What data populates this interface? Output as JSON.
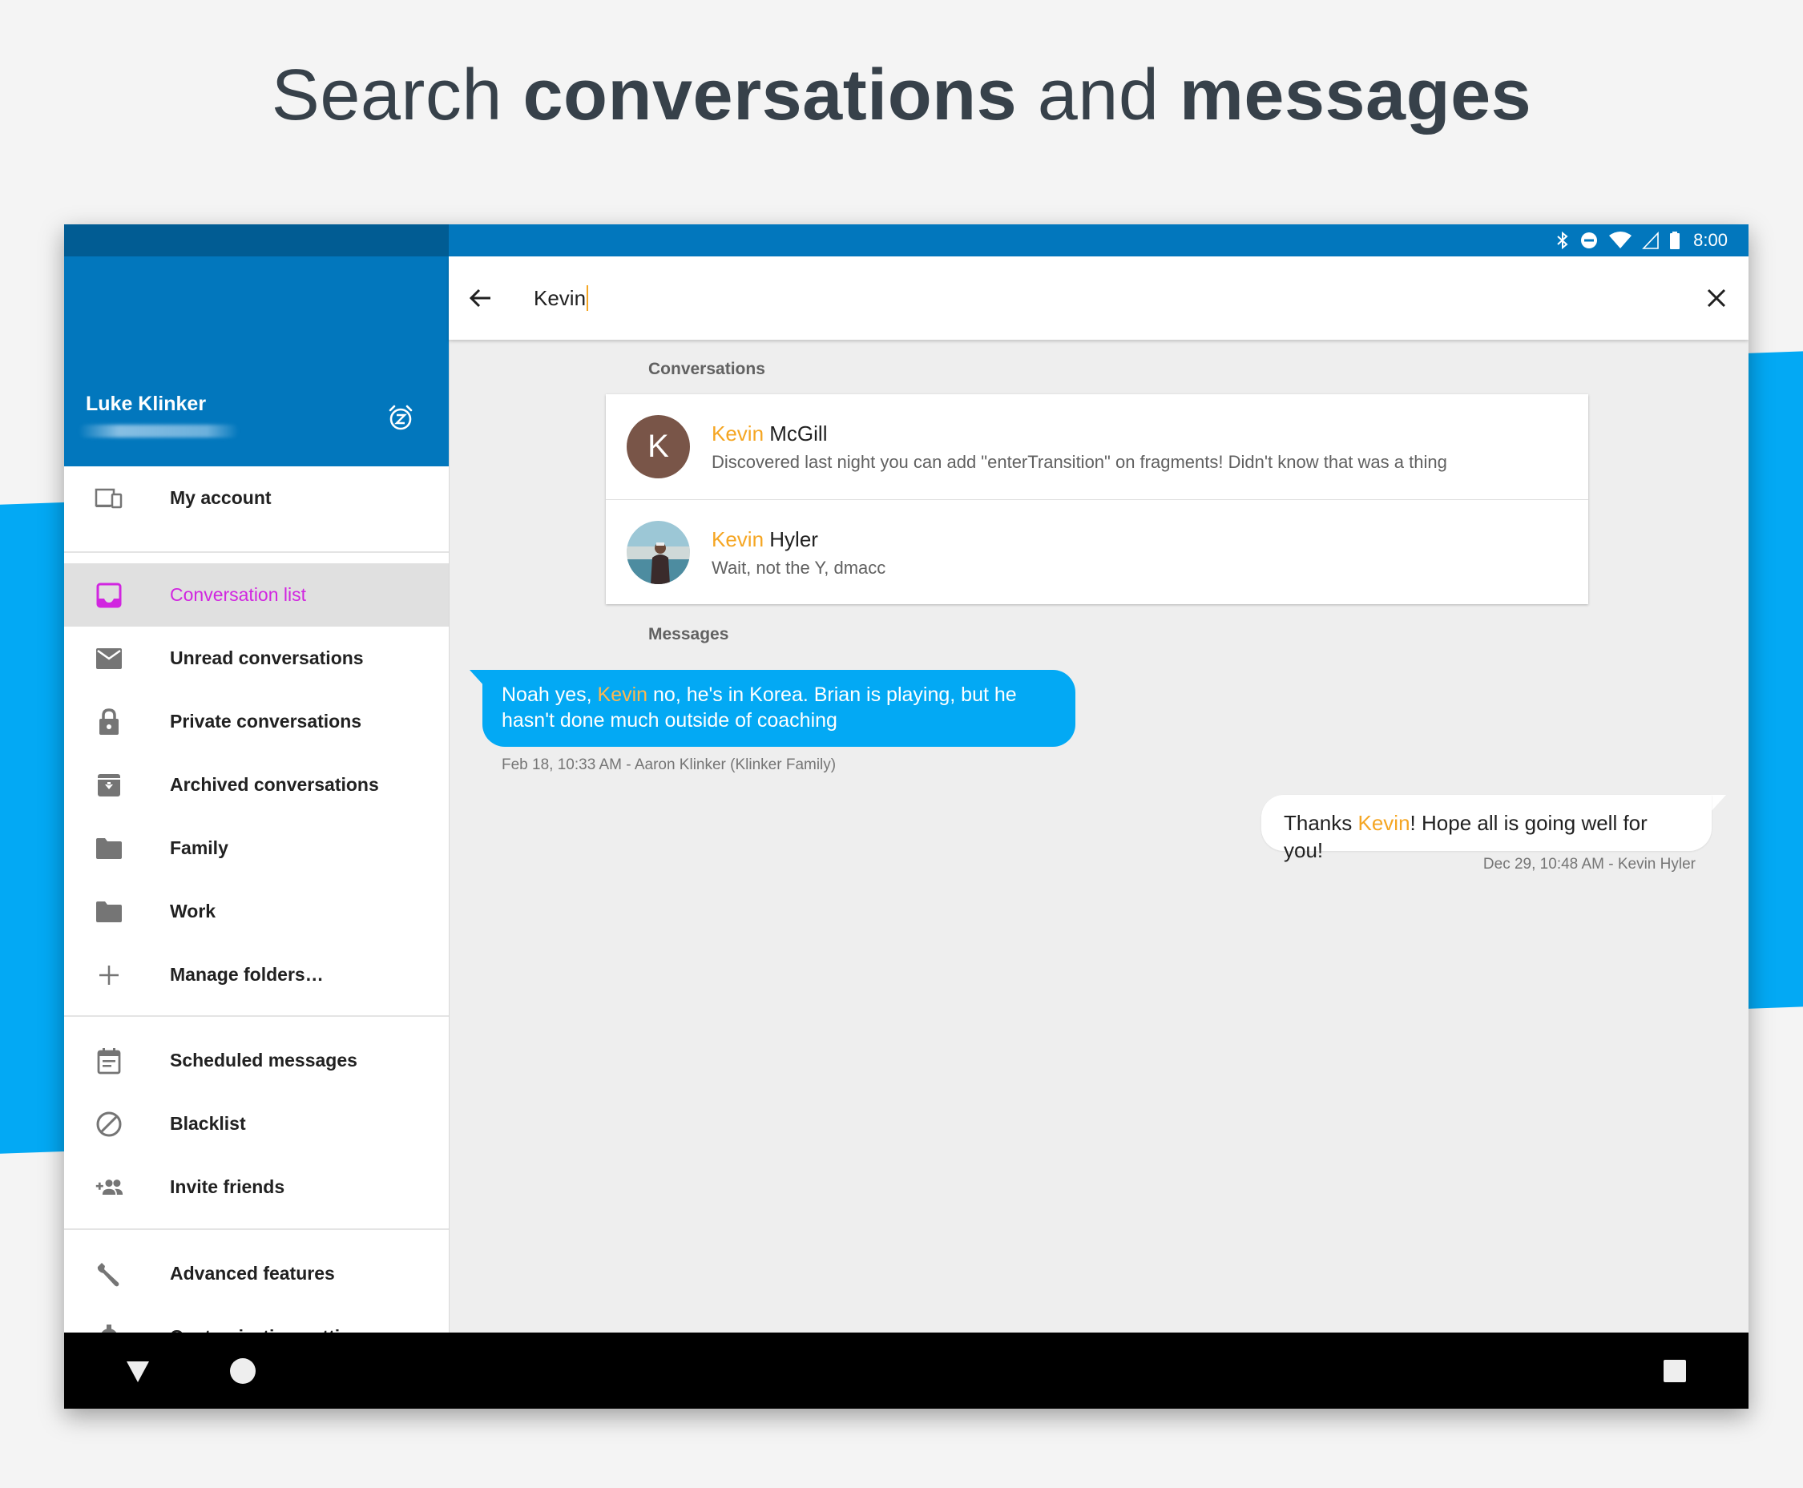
{
  "headline": {
    "part1": "Search ",
    "part2": "conversations",
    "part3": " and ",
    "part4": "messages"
  },
  "status_bar": {
    "time": "8:00",
    "icons": [
      "bluetooth-icon",
      "do-not-disturb-icon",
      "wifi-icon",
      "signal-icon",
      "battery-icon"
    ]
  },
  "drawer": {
    "user_name": "Luke Klinker",
    "snooze_icon": "snooze-alarm-icon",
    "items": [
      {
        "label": "My account",
        "icon": "devices-icon"
      },
      {
        "label": "Conversation list",
        "icon": "inbox-icon",
        "active": true
      },
      {
        "label": "Unread conversations",
        "icon": "mail-icon"
      },
      {
        "label": "Private conversations",
        "icon": "lock-icon"
      },
      {
        "label": "Archived conversations",
        "icon": "archive-icon"
      },
      {
        "label": "Family",
        "icon": "folder-icon"
      },
      {
        "label": "Work",
        "icon": "folder-icon"
      },
      {
        "label": "Manage folders…",
        "icon": "plus-icon"
      },
      {
        "label": "Scheduled messages",
        "icon": "calendar-icon"
      },
      {
        "label": "Blacklist",
        "icon": "block-icon"
      },
      {
        "label": "Invite friends",
        "icon": "group-add-icon"
      },
      {
        "label": "Advanced features",
        "icon": "wrench-icon"
      },
      {
        "label": "Customization settings",
        "icon": "gear-icon"
      }
    ]
  },
  "search": {
    "query": "Kevin"
  },
  "sections": {
    "conversations": "Conversations",
    "messages": "Messages"
  },
  "conversations": [
    {
      "match": "Kevin",
      "rest": " McGill",
      "snippet": "Discovered last night you can add \"enterTransition\" on fragments! Didn't know that was a thing",
      "avatar_letter": "K",
      "avatar_color": "#795548"
    },
    {
      "match": "Kevin",
      "rest": " Hyler",
      "snippet": "Wait, not the Y, dmacc",
      "avatar_color": "#4a8aa0"
    }
  ],
  "messages": [
    {
      "direction": "incoming",
      "before": "Noah yes, ",
      "match": "Kevin",
      "after": " no, he's in Korea. Brian is playing, but he hasn't done much outside of coaching",
      "meta": "Feb 18, 10:33 AM - Aaron Klinker (Klinker Family)",
      "bubble_color": "#03a9f4"
    },
    {
      "direction": "outgoing",
      "before": "Thanks ",
      "match": "Kevin",
      "after": "! Hope all is going well for you!",
      "meta": "Dec 29, 10:48 AM - Kevin Hyler",
      "bubble_color": "#ffffff"
    }
  ],
  "colors": {
    "primary": "#0277bd",
    "primary_dark": "#015c93",
    "accent": "#d126e0",
    "highlight": "#f5a623",
    "stripe": "#03a9f4"
  },
  "nav_bar": {
    "icons": [
      "back-triangle-icon",
      "home-circle-icon",
      "recents-square-icon"
    ]
  }
}
